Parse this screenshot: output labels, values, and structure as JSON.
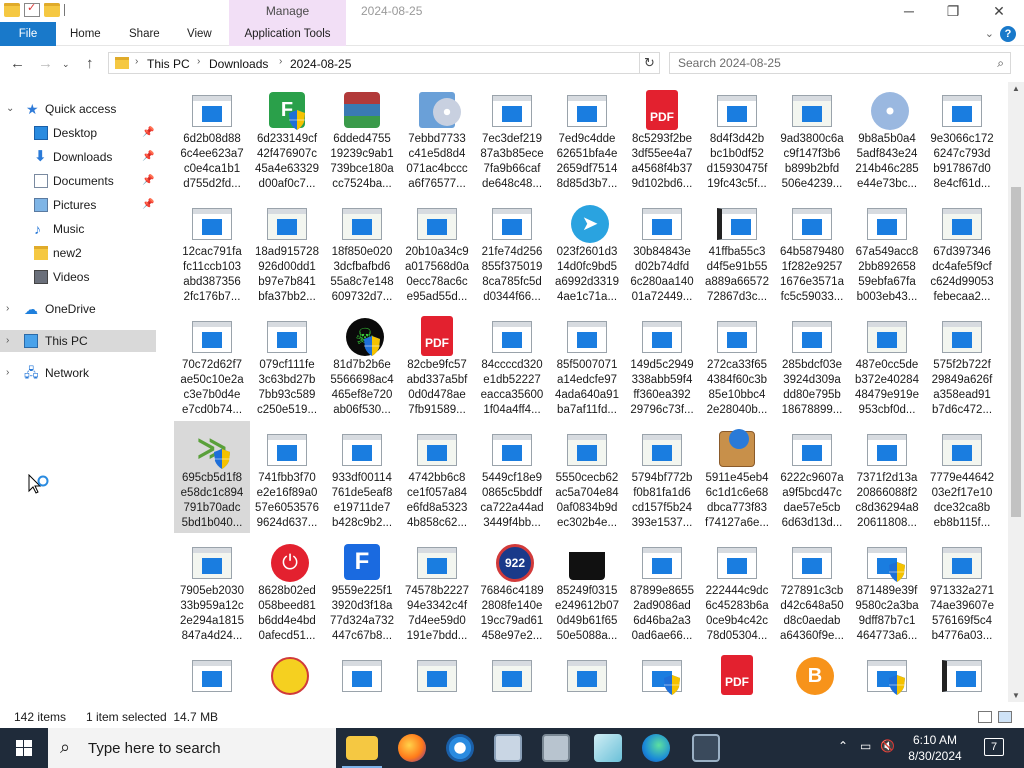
{
  "titlebar": {
    "manage_label": "Manage",
    "window_title": "2024-08-25",
    "minimize": "─",
    "maximize": "❐",
    "close": "✕"
  },
  "ribbon": {
    "tabs": [
      {
        "label": "File"
      },
      {
        "label": "Home"
      },
      {
        "label": "Share"
      },
      {
        "label": "View"
      },
      {
        "label": "Application Tools"
      }
    ],
    "help": "?"
  },
  "address": {
    "crumbs": [
      "This PC",
      "Downloads",
      "2024-08-25"
    ],
    "search_placeholder": "Search 2024-08-25"
  },
  "nav": {
    "items": [
      {
        "label": "Quick access",
        "icon": "star-icon",
        "pinned": false
      },
      {
        "label": "Desktop",
        "icon": "desktop-icon",
        "pinned": true
      },
      {
        "label": "Downloads",
        "icon": "downloads-icon",
        "pinned": true
      },
      {
        "label": "Documents",
        "icon": "documents-icon",
        "pinned": true
      },
      {
        "label": "Pictures",
        "icon": "pictures-icon",
        "pinned": true
      },
      {
        "label": "Music",
        "icon": "music-icon",
        "pinned": false
      },
      {
        "label": "new2",
        "icon": "folder-icon",
        "pinned": false
      },
      {
        "label": "Videos",
        "icon": "videos-icon",
        "pinned": false
      },
      {
        "label": "OneDrive",
        "icon": "onedrive-icon",
        "pinned": false
      },
      {
        "label": "This PC",
        "icon": "this-pc-icon",
        "pinned": false
      },
      {
        "label": "Network",
        "icon": "network-icon",
        "pinned": false
      }
    ]
  },
  "files": [
    {
      "name": "6d2b08d88\n6c4ee623a7\nc0e4ca1b1\nd755d2fd...",
      "type": "exe"
    },
    {
      "name": "6d233149cf\n42f476907c\n45a4e63329\nd00af0c7...",
      "type": "installer-green"
    },
    {
      "name": "6dded4755\n19239c9ab1\n739bce180a\ncc7524ba...",
      "type": "archive"
    },
    {
      "name": "7ebbd7733\nc41e5d8d4\n071ac4bccc\na6f76577...",
      "type": "setup-disc"
    },
    {
      "name": "7ec3def219\n87a3b85ece\n7fa9b66caf\nde648c48...",
      "type": "exe"
    },
    {
      "name": "7ed9c4dde\n62651bfa4e\n2659df7514\n8d85d3b7...",
      "type": "exe"
    },
    {
      "name": "8c5293f2be\n3df55ee4a7\na4568f4b37\n9d102bd6...",
      "type": "pdf"
    },
    {
      "name": "8d4f3d42b\nbc1b0df52\nd15930475f\n19fc43c5f...",
      "type": "exe"
    },
    {
      "name": "9ad3800c6a\nc9f147f3b6\nb899b2bfd\n506e4239...",
      "type": "window"
    },
    {
      "name": "9b8a5b0a4\n5adf843e24\n214b46c285\ne44e73bc...",
      "type": "disc"
    },
    {
      "name": "9e3066c172\n6247c793d\nb917867d0\n8e4cf61d...",
      "type": "exe"
    },
    {
      "name": "12cac791fa\nfc11ccb103\nabd387356\n2fc176b7...",
      "type": "exe"
    },
    {
      "name": "18ad915728\n926d00dd1\nb97e7b841\nbfa37bb2...",
      "type": "window"
    },
    {
      "name": "18f850e020\n3dcfbafbd6\n55a8c7e148\n609732d7...",
      "type": "window"
    },
    {
      "name": "20b10a34c9\na017568d0a\n0ecc78ac6c\ne95ad55d...",
      "type": "window"
    },
    {
      "name": "21fe74d256\n855f375019\n8ca785fc5d\nd0344f66...",
      "type": "exe"
    },
    {
      "name": "023f2601d3\n14d0fc9bd5\na6992d3319\n4ae1c71a...",
      "type": "telegram"
    },
    {
      "name": "30b84843e\nd02b74dfd\n6c280aa140\n01a72449...",
      "type": "exe"
    },
    {
      "name": "41ffba55c3\nd4f5e91b55\na889a66572\n72867d3c...",
      "type": "film"
    },
    {
      "name": "64b5879480\n1f282e9257\n1676e3571a\nfc5c59033...",
      "type": "exe"
    },
    {
      "name": "67a549acc8\n2bb892658\n59ebfa67fa\nb003eb43...",
      "type": "exe"
    },
    {
      "name": "67d397346\ndc4afe5f9cf\nc624d99053\nfebecaa2...",
      "type": "window"
    },
    {
      "name": "70c72d62f7\nae50c10e2a\nc3e7b0d4e\ne7cd0b74...",
      "type": "exe"
    },
    {
      "name": "079cf111fe\n3c63bd27b\n7bb93c589\nc250e519...",
      "type": "exe"
    },
    {
      "name": "81d7b2b6e\n5566698ac4\n465ef8e720\nab06f530...",
      "type": "skull"
    },
    {
      "name": "82cbe9fc57\nabd337a5bf\n0d0d478ae\n7fb91589...",
      "type": "pdf"
    },
    {
      "name": "84ccccd320\ne1db52227\neacca35600\n1f04a4ff4...",
      "type": "exe"
    },
    {
      "name": "85f5007071\na14edcfe97\n4ada640a91\nba7af11fd...",
      "type": "exe"
    },
    {
      "name": "149d5c2949\n338abb59f4\nff360ea392\n29796c73f...",
      "type": "exe"
    },
    {
      "name": "272ca33f65\n4384f60c3b\n85e10bbc4\n2e28040b...",
      "type": "exe"
    },
    {
      "name": "285bdcf03e\n3924d309a\ndd80e795b\n18678899...",
      "type": "exe"
    },
    {
      "name": "487e0cc5de\nb372e40284\n48479e919e\n953cbf0d...",
      "type": "window"
    },
    {
      "name": "575f2b722f\n29849a626f\na358ead91\nb7d6c472...",
      "type": "window"
    },
    {
      "name": "695cb5d1f8\ne58dc1c894\n791b70adc\n5bd1b040...",
      "type": "xamarin",
      "selected": true
    },
    {
      "name": "741fbb3f70\ne2e16f89a0\n57e6053576\n9624d637...",
      "type": "exe"
    },
    {
      "name": "933df00114\n761de5eaf8\ne19711de7\nb428c9b2...",
      "type": "exe"
    },
    {
      "name": "4742bb6c8\nce1f057a84\ne6fd8a5323\n4b858c62...",
      "type": "window"
    },
    {
      "name": "5449cf18e9\n0865c5bddf\nca722a44ad\n3449f4bb...",
      "type": "exe"
    },
    {
      "name": "5550cecb62\nac5a704e84\n0af0834b9d\nec302b4e...",
      "type": "window"
    },
    {
      "name": "5794bf772b\nf0b81fa1d6\ncd157f5b24\n393e1537...",
      "type": "window"
    },
    {
      "name": "5911e45eb4\n6c1d1c6e68\ndbca773f83\nf74127a6e...",
      "type": "package"
    },
    {
      "name": "6222c9607a\na9f5bcd47c\ndae57e5cb\n6d63d13d...",
      "type": "exe"
    },
    {
      "name": "7371f2d13a\n20866088f2\nc8d36294a8\n20611808...",
      "type": "exe"
    },
    {
      "name": "7779e44642\n03e2f17e10\ndce32ca8b\neb8b115f...",
      "type": "window"
    },
    {
      "name": "7905eb2030\n33b959a12c\n2e294a1815\n847a4d24...",
      "type": "window"
    },
    {
      "name": "8628b02ed\n058beed81\nb6dd4e4bd\n0afecd51...",
      "type": "power"
    },
    {
      "name": "9559e225f1\n3920d3f18a\n77d324a732\n447c67b8...",
      "type": "fortnite"
    },
    {
      "name": "74578b2227\n94e3342c4f\n7d4ee59d0\n191e7bdd...",
      "type": "window"
    },
    {
      "name": "76846c4189\n2808fe140e\n19cc79ad61\n458e97e2...",
      "type": "922"
    },
    {
      "name": "85249f0315\ne249612b07\n0d49b61f65\n50e5088a...",
      "type": "clapper"
    },
    {
      "name": "87899e8655\n2ad9086ad\n6d46ba2a3\n0ad6ae66...",
      "type": "exe"
    },
    {
      "name": "222444c9dc\n6c45283b6a\n0ce9b4c42c\n78d05304...",
      "type": "exe"
    },
    {
      "name": "727891c3cb\nd42c648a50\nd8c0aedab\na64360f9e...",
      "type": "exe"
    },
    {
      "name": "871489e39f\n9580c2a3ba\n9dff87b7c1\n464773a6...",
      "type": "download-shield"
    },
    {
      "name": "971332a271\n74ae39607e\n576169f5c4\nb4776a03...",
      "type": "window"
    },
    {
      "name": "",
      "type": "exe"
    },
    {
      "name": "",
      "type": "hand"
    },
    {
      "name": "",
      "type": "exe"
    },
    {
      "name": "",
      "type": "window"
    },
    {
      "name": "",
      "type": "window"
    },
    {
      "name": "",
      "type": "window"
    },
    {
      "name": "",
      "type": "exe-shield"
    },
    {
      "name": "",
      "type": "pdf"
    },
    {
      "name": "",
      "type": "bitcoin"
    },
    {
      "name": "",
      "type": "exe-shield"
    },
    {
      "name": "",
      "type": "film"
    }
  ],
  "status": {
    "item_count": "142 items",
    "selection": "1 item selected  14.7 MB"
  },
  "taskbar": {
    "search_text": "Type here to search",
    "time": "6:10 AM",
    "date": "8/30/2024"
  },
  "colors": {
    "accent": "#1979ca",
    "selection": "#d9d9d9",
    "manage_tab": "#f2dff6",
    "taskbar": "#1f2b3a"
  }
}
